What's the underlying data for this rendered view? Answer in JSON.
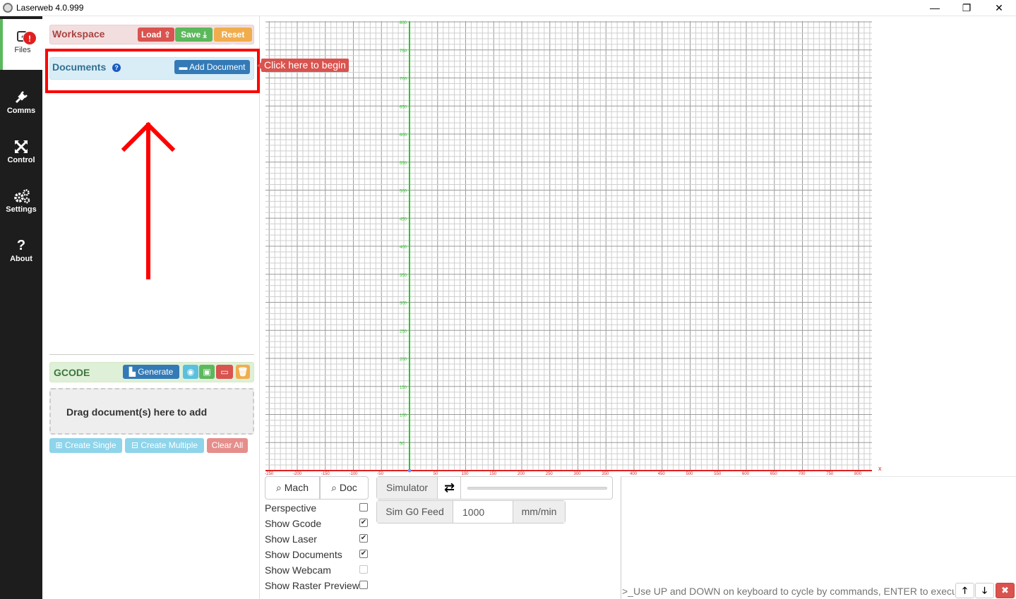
{
  "window": {
    "title": "Laserweb 4.0.999",
    "minimize": "—",
    "maximize": "❐",
    "close": "✕"
  },
  "nav": {
    "files": "Files",
    "files_alert": "!",
    "comms": "Comms",
    "control": "Control",
    "settings": "Settings",
    "about": "About"
  },
  "workspace": {
    "title": "Workspace",
    "load": "Load",
    "save": "Save",
    "reset": "Reset"
  },
  "documents": {
    "title": "Documents",
    "help": "?",
    "add_document": "Add Document",
    "hint": "Click here to begin"
  },
  "gcode": {
    "title": "GCODE",
    "generate": "Generate",
    "drop_text": "Drag document(s) here to add",
    "create_single": "Create Single",
    "create_multiple": "Create Multiple",
    "clear_all": "Clear All"
  },
  "canvas": {
    "y_ticks": [
      "800",
      "750",
      "700",
      "650",
      "600",
      "550",
      "500",
      "450",
      "400",
      "350",
      "300",
      "250",
      "200",
      "150",
      "100",
      "50"
    ],
    "x_ticks": [
      "-250",
      "-200",
      "-150",
      "-100",
      "-50",
      "",
      "50",
      "100",
      "150",
      "200",
      "250",
      "300",
      "350",
      "400",
      "450",
      "500",
      "550",
      "600",
      "650",
      "700",
      "750",
      "800"
    ],
    "x_axis_label": "x"
  },
  "view": {
    "mach": "Mach",
    "doc": "Doc",
    "simulator": "Simulator",
    "sim_g0_feed": "Sim G0 Feed",
    "feed_value": "1000",
    "feed_unit": "mm/min"
  },
  "options": [
    {
      "label": "Perspective",
      "checked": false,
      "enabled": true
    },
    {
      "label": "Show Gcode",
      "checked": true,
      "enabled": true
    },
    {
      "label": "Show Laser",
      "checked": true,
      "enabled": true
    },
    {
      "label": "Show Documents",
      "checked": true,
      "enabled": true
    },
    {
      "label": "Show Webcam",
      "checked": false,
      "enabled": false
    },
    {
      "label": "Show Raster Preview",
      "checked": false,
      "enabled": true
    }
  ],
  "terminal": {
    "placeholder": ">_Use UP and DOWN on keyboard to cycle by commands, ENTER to execute"
  },
  "colors": {
    "nav_bg": "#1d1d1d",
    "y_axis": "#22cc22",
    "x_axis": "#dd2222",
    "grid_minor": "#cfcfcf",
    "grid_major": "#9a9a9a",
    "arrow": "#ff0000"
  }
}
